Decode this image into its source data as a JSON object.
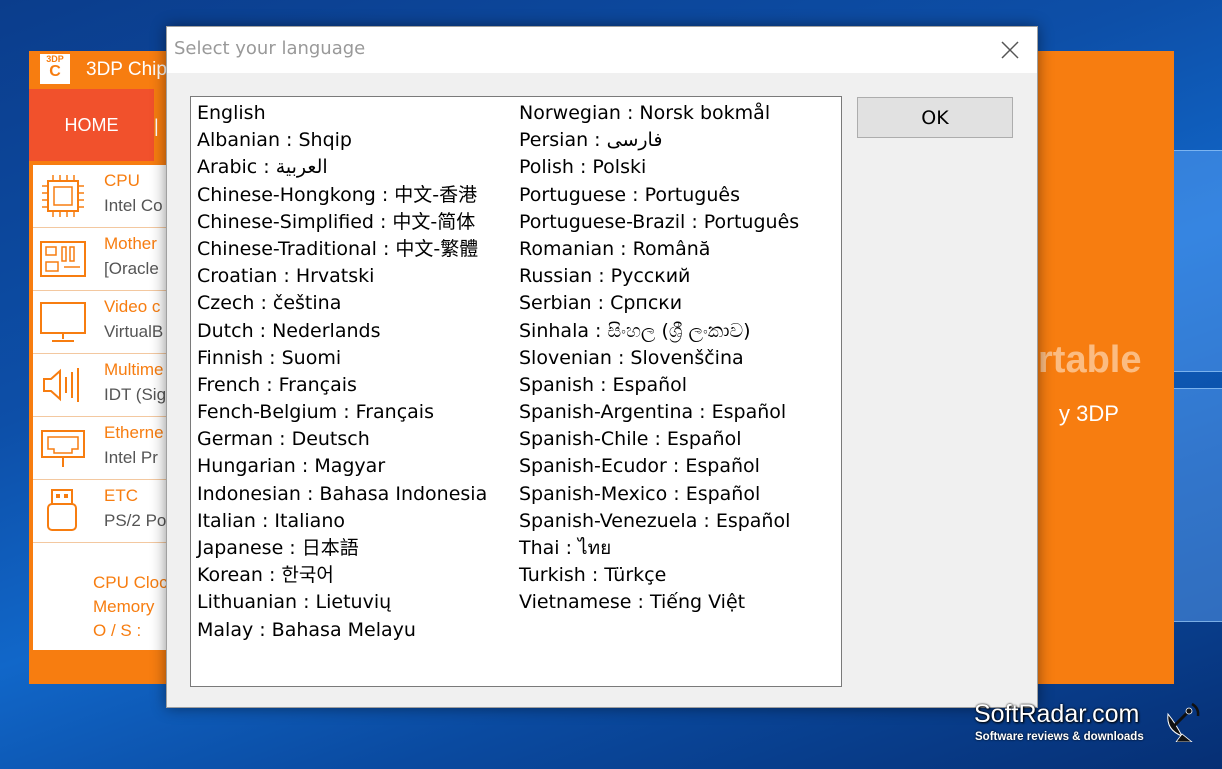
{
  "background_app": {
    "logo_top": "3DP",
    "logo_bottom": "C",
    "title": "3DP Chip",
    "home_tab": "HOME",
    "tab_separator": "|",
    "hardware_items": [
      {
        "name": "CPU",
        "value": "Intel Co",
        "icon": "cpu-icon"
      },
      {
        "name": "Mother",
        "value": "[Oracle",
        "icon": "motherboard-icon"
      },
      {
        "name": "Video c",
        "value": "VirtualB",
        "icon": "monitor-icon"
      },
      {
        "name": "Multime",
        "value": "IDT (Sig",
        "icon": "speaker-icon"
      },
      {
        "name": "Etherne",
        "value": "Intel Pr",
        "icon": "ethernet-icon"
      },
      {
        "name": "ETC",
        "value": "PS/2 Po",
        "icon": "usb-icon"
      }
    ],
    "summary": [
      "CPU Cloc",
      "Memory",
      "O / S :"
    ],
    "promo_text": "rtable",
    "promo_sub": "y 3DP",
    "accent_color": "#f77d10"
  },
  "dialog": {
    "title": "Select your language",
    "ok_label": "OK",
    "languages_left": [
      "English",
      "Albanian : Shqip",
      "Arabic : العربية",
      "Chinese-Hongkong : 中文-香港",
      "Chinese-Simplified : 中文-简体",
      "Chinese-Traditional : 中文-繁體",
      "Croatian : Hrvatski",
      "Czech : čeština",
      "Dutch : Nederlands",
      "Finnish : Suomi",
      "French : Français",
      "Fench-Belgium : Français",
      "German : Deutsch",
      "Hungarian : Magyar",
      "Indonesian : Bahasa Indonesia",
      "Italian : Italiano",
      "Japanese : 日本語",
      "Korean : 한국어",
      "Lithuanian : Lietuvių",
      "Malay : Bahasa Melayu"
    ],
    "languages_right": [
      "Norwegian : Norsk bokmål",
      "Persian : فارسی",
      "Polish : Polski",
      "Portuguese : Português",
      "Portuguese-Brazil : Português",
      "Romanian : Română",
      "Russian : Русский",
      "Serbian : Српски",
      "Sinhala : සිංහල (ශ්‍රී ලංකාව)",
      "Slovenian : Slovenščina",
      "Spanish : Español",
      "Spanish-Argentina : Español",
      "Spanish-Chile : Español",
      "Spanish-Ecudor : Español",
      "Spanish-Mexico : Español",
      "Spanish-Venezuela : Español",
      "Thai : ไทย",
      "Turkish : Türkçe",
      "Vietnamese : Tiếng Việt"
    ]
  },
  "watermark": {
    "name": "SoftRadar.com",
    "tagline": "Software reviews & downloads"
  }
}
